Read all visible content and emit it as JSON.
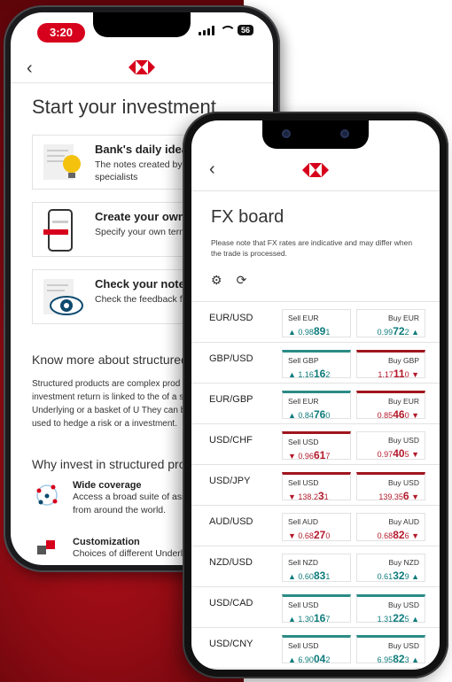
{
  "back_phone": {
    "status_time": "3:20",
    "battery": "56",
    "title": "Start your investment",
    "cards": [
      {
        "title": "Bank's daily idea(s)",
        "desc": "The notes created by o product specialists"
      },
      {
        "title": "Create your own no",
        "desc": "Specify your own tern features"
      },
      {
        "title": "Check your note(s)",
        "desc": "Check the feedback fr counterparties"
      }
    ],
    "know_more": "Know more about structured",
    "paragraph": "Structured products are complex prod their investment return is linked to the of a single Underlying or a basket of U They can be used to hedge a risk or a investment.",
    "why_invest": "Why invest in structured pro",
    "features": [
      {
        "title": "Wide coverage",
        "desc": "Access a broad suite of ass from around the world."
      },
      {
        "title": "Customization",
        "desc": "Choices of different Underl"
      }
    ]
  },
  "fx_board": {
    "title": "FX board",
    "note": "Please note that FX rates are indicative and may differ when the trade is processed.",
    "rows": [
      {
        "pair": "EUR/USD",
        "sell_label": "Sell EUR",
        "sell_pre": "0.98",
        "sell_big": "89",
        "sell_post": "1",
        "sell_dir": "up",
        "buy_label": "Buy EUR",
        "buy_pre": "0.99",
        "buy_big": "72",
        "buy_post": "2",
        "buy_dir": "up",
        "bar_sell": "",
        "bar_buy": ""
      },
      {
        "pair": "GBP/USD",
        "sell_label": "Sell GBP",
        "sell_pre": "1.16",
        "sell_big": "16",
        "sell_post": "2",
        "sell_dir": "up",
        "buy_label": "Buy GBP",
        "buy_pre": "1.17",
        "buy_big": "11",
        "buy_post": "0",
        "buy_dir": "down",
        "bar_sell": "up",
        "bar_buy": "down"
      },
      {
        "pair": "EUR/GBP",
        "sell_label": "Sell EUR",
        "sell_pre": "0.84",
        "sell_big": "76",
        "sell_post": "0",
        "sell_dir": "up",
        "buy_label": "Buy EUR",
        "buy_pre": "0.85",
        "buy_big": "46",
        "buy_post": "0",
        "buy_dir": "down",
        "bar_sell": "up",
        "bar_buy": "down"
      },
      {
        "pair": "USD/CHF",
        "sell_label": "Sell USD",
        "sell_pre": "0.96",
        "sell_big": "61",
        "sell_post": "7",
        "sell_dir": "down",
        "buy_label": "Buy USD",
        "buy_pre": "0.97",
        "buy_big": "40",
        "buy_post": "5",
        "buy_dir": "down",
        "bar_sell": "down",
        "bar_buy": ""
      },
      {
        "pair": "USD/JPY",
        "sell_label": "Sell USD",
        "sell_pre": "138.2",
        "sell_big": "3",
        "sell_post": "1",
        "sell_dir": "down",
        "buy_label": "Buy USD",
        "buy_pre": "139.35",
        "buy_big": "6",
        "buy_post": "",
        "buy_dir": "down",
        "bar_sell": "down",
        "bar_buy": "down"
      },
      {
        "pair": "AUD/USD",
        "sell_label": "Sell AUD",
        "sell_pre": "0.68",
        "sell_big": "27",
        "sell_post": "0",
        "sell_dir": "down",
        "buy_label": "Buy AUD",
        "buy_pre": "0.68",
        "buy_big": "82",
        "buy_post": "6",
        "buy_dir": "down",
        "bar_sell": "",
        "bar_buy": ""
      },
      {
        "pair": "NZD/USD",
        "sell_label": "Sell NZD",
        "sell_pre": "0.60",
        "sell_big": "83",
        "sell_post": "1",
        "sell_dir": "up",
        "buy_label": "Buy NZD",
        "buy_pre": "0.61",
        "buy_big": "32",
        "buy_post": "9",
        "buy_dir": "up",
        "bar_sell": "",
        "bar_buy": ""
      },
      {
        "pair": "USD/CAD",
        "sell_label": "Sell USD",
        "sell_pre": "1.30",
        "sell_big": "16",
        "sell_post": "7",
        "sell_dir": "up",
        "buy_label": "Buy USD",
        "buy_pre": "1.31",
        "buy_big": "22",
        "buy_post": "5",
        "buy_dir": "up",
        "bar_sell": "up",
        "bar_buy": "up"
      },
      {
        "pair": "USD/CNY",
        "sell_label": "Sell USD",
        "sell_pre": "6.90",
        "sell_big": "04",
        "sell_post": "2",
        "sell_dir": "up",
        "buy_label": "Buy USD",
        "buy_pre": "6.95",
        "buy_big": "82",
        "buy_post": "3",
        "buy_dir": "up",
        "bar_sell": "up",
        "bar_buy": "up"
      }
    ]
  },
  "colors": {
    "brand_red": "#d7001c",
    "up": "#0e7b7b",
    "down": "#b3192b"
  },
  "icons": [
    "back-chevron-icon",
    "logo-hexagon-icon",
    "settings-gear-icon",
    "refresh-icon",
    "lightbulb-icon",
    "phone-mock-icon",
    "eye-icon",
    "globe-network-icon",
    "puzzle-icon"
  ]
}
